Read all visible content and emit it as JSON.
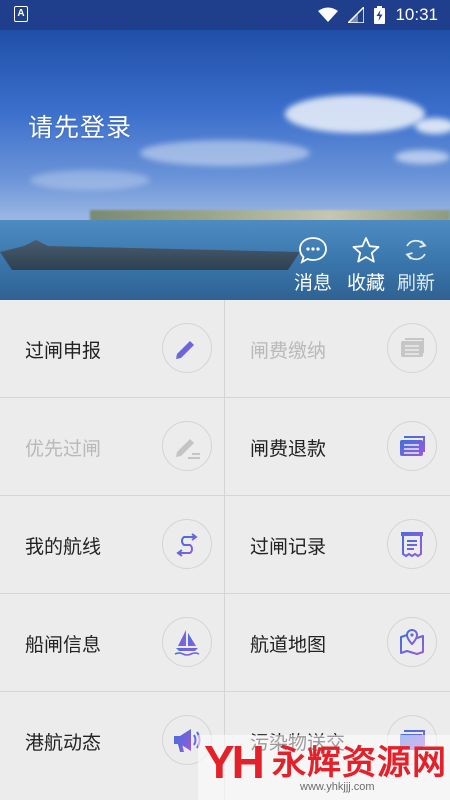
{
  "status_bar": {
    "time": "10:31",
    "notification_icon": "A"
  },
  "header": {
    "login_text": "请先登录"
  },
  "header_actions": [
    {
      "label": "消息",
      "icon": "chat-bubble-icon"
    },
    {
      "label": "收藏",
      "icon": "star-icon"
    },
    {
      "label": "刷新",
      "icon": "refresh-icon"
    }
  ],
  "menu": [
    {
      "label": "过闸申报",
      "enabled": true,
      "icon": "pen-edit-icon"
    },
    {
      "label": "闸费缴纳",
      "enabled": false,
      "icon": "payment-card-icon"
    },
    {
      "label": "优先过闸",
      "enabled": false,
      "icon": "pen-edit-icon"
    },
    {
      "label": "闸费退款",
      "enabled": true,
      "icon": "refund-card-icon"
    },
    {
      "label": "我的航线",
      "enabled": true,
      "icon": "route-icon"
    },
    {
      "label": "过闸记录",
      "enabled": true,
      "icon": "receipt-icon"
    },
    {
      "label": "船闸信息",
      "enabled": true,
      "icon": "sailboat-icon"
    },
    {
      "label": "航道地图",
      "enabled": true,
      "icon": "map-pin-icon"
    },
    {
      "label": "港航动态",
      "enabled": true,
      "icon": "megaphone-icon"
    },
    {
      "label": "污染物送交",
      "enabled": true,
      "icon": "delivery-card-icon"
    }
  ],
  "watermark": {
    "logo": "YH",
    "name": "永辉资源网",
    "url": "www.yhkjjj.com"
  },
  "colors": {
    "accent_start": "#3f6fe0",
    "accent_end": "#9a5ad8",
    "disabled": "#b9b9b9",
    "status_bar": "#1f3e8c"
  }
}
